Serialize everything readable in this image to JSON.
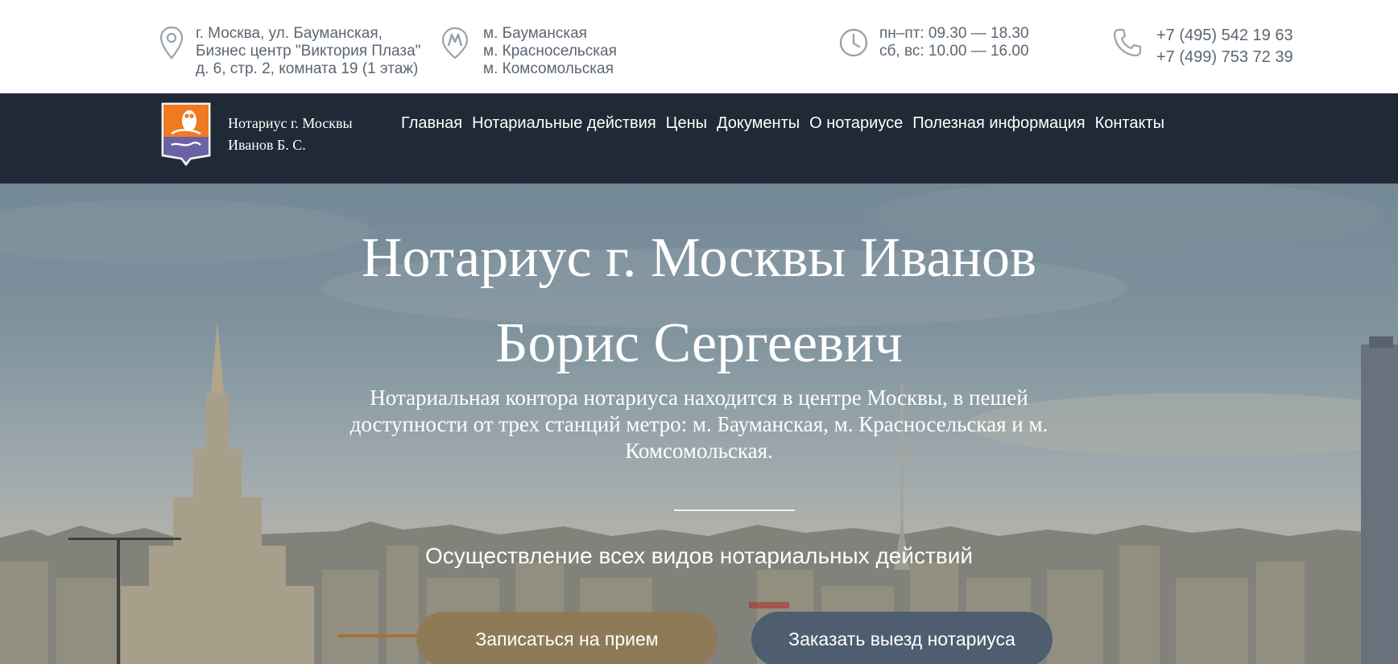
{
  "topbar": {
    "address": [
      "г. Москва, ул. Бауманская,",
      "Бизнес центр \"Виктория Плаза\"",
      "д. 6, стр. 2, комната 19 (1 этаж)"
    ],
    "metro": [
      "м. Бауманская",
      "м. Красносельская",
      "м. Комсомольская"
    ],
    "hours": [
      "пн–пт: 09.30 — 18.30",
      "сб, вс: 10.00 — 16.00"
    ],
    "phones": [
      "+7 (495) 542 19 63",
      "+7 (499) 753 72 39"
    ],
    "icons": {
      "address": "map-pin-icon",
      "metro": "metro-icon",
      "hours": "clock-icon",
      "phones": "phone-icon"
    }
  },
  "navbar": {
    "brand": [
      "Нотариус г. Москвы",
      "Иванов Б. С."
    ],
    "items": [
      "Главная",
      "Нотариальные действия",
      "Цены",
      "Документы",
      "О нотариусе",
      "Полезная информация",
      "Контакты"
    ]
  },
  "hero": {
    "title_line1": "Нотариус г. Москвы Иванов",
    "title_line2": "Борис Сергеевич",
    "lead": "Нотариальная контора нотариуса находится в центре Москвы, в пешей доступности от трех станций метро: м. Бауманская, м. Красносельская и м. Комсомольская.",
    "subtitle": "Осуществление всех видов нотариальных действий",
    "primary_button": "Записаться на прием",
    "secondary_button": "Заказать выезд нотариуса"
  },
  "colors": {
    "navbar_bg": "#1f2a36",
    "primary_button": "#8f7a57",
    "secondary_button": "#4e5e6e",
    "info_text": "#5b6672",
    "logo_orange": "#f07a22",
    "logo_purple": "#6b62a6"
  }
}
